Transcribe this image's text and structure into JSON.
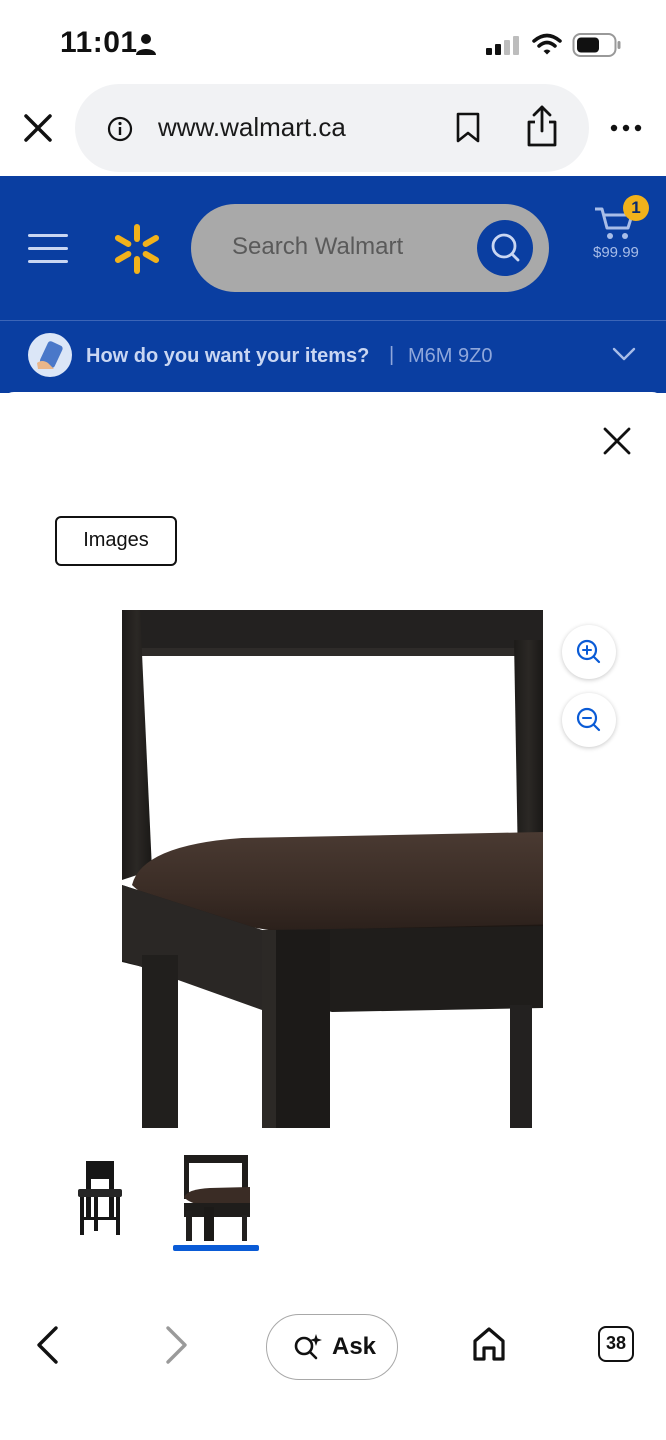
{
  "status_bar": {
    "time": "11:01"
  },
  "browser": {
    "url": "www.walmart.ca",
    "open_tabs": "38",
    "ask_label": "Ask"
  },
  "walmart_header": {
    "search_placeholder": "Search Walmart",
    "cart_count": "1",
    "cart_total": "$99.99",
    "delivery_prompt": "How do you want your items?",
    "delivery_separator": "|",
    "postal_code": "M6M 9Z0"
  },
  "gallery": {
    "images_button_label": "Images",
    "selected_thumbnail_index": 2,
    "thumbnail_count": 2
  },
  "colors": {
    "brand_blue": "#0a3ea1",
    "spark_yellow": "#f2b21b",
    "selected_underline": "#0a5bd6"
  }
}
